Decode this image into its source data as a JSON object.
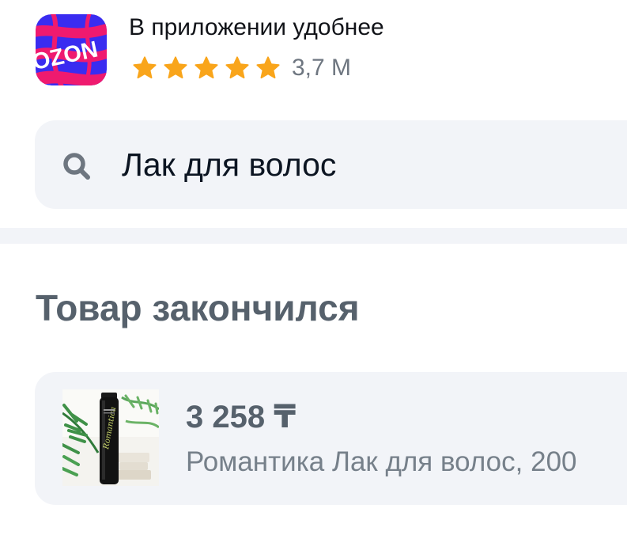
{
  "app_banner": {
    "title": "В приложении удобнее",
    "rating_count": "3,7 М",
    "stars": 5,
    "logo_text": "OZON",
    "icon": "ozon-app-icon"
  },
  "search": {
    "query": "Лак для волос",
    "icon": "search-icon"
  },
  "section": {
    "title": "Товар закончился"
  },
  "product": {
    "price": "3 258 ₸",
    "name": "Романтика Лак для волос, 200"
  },
  "colors": {
    "star": "#f9a51b",
    "logo_pink": "#ef1a6f",
    "logo_blue": "#3a2cf0",
    "card_bg": "#f2f4f8",
    "muted_text": "#56616c"
  }
}
